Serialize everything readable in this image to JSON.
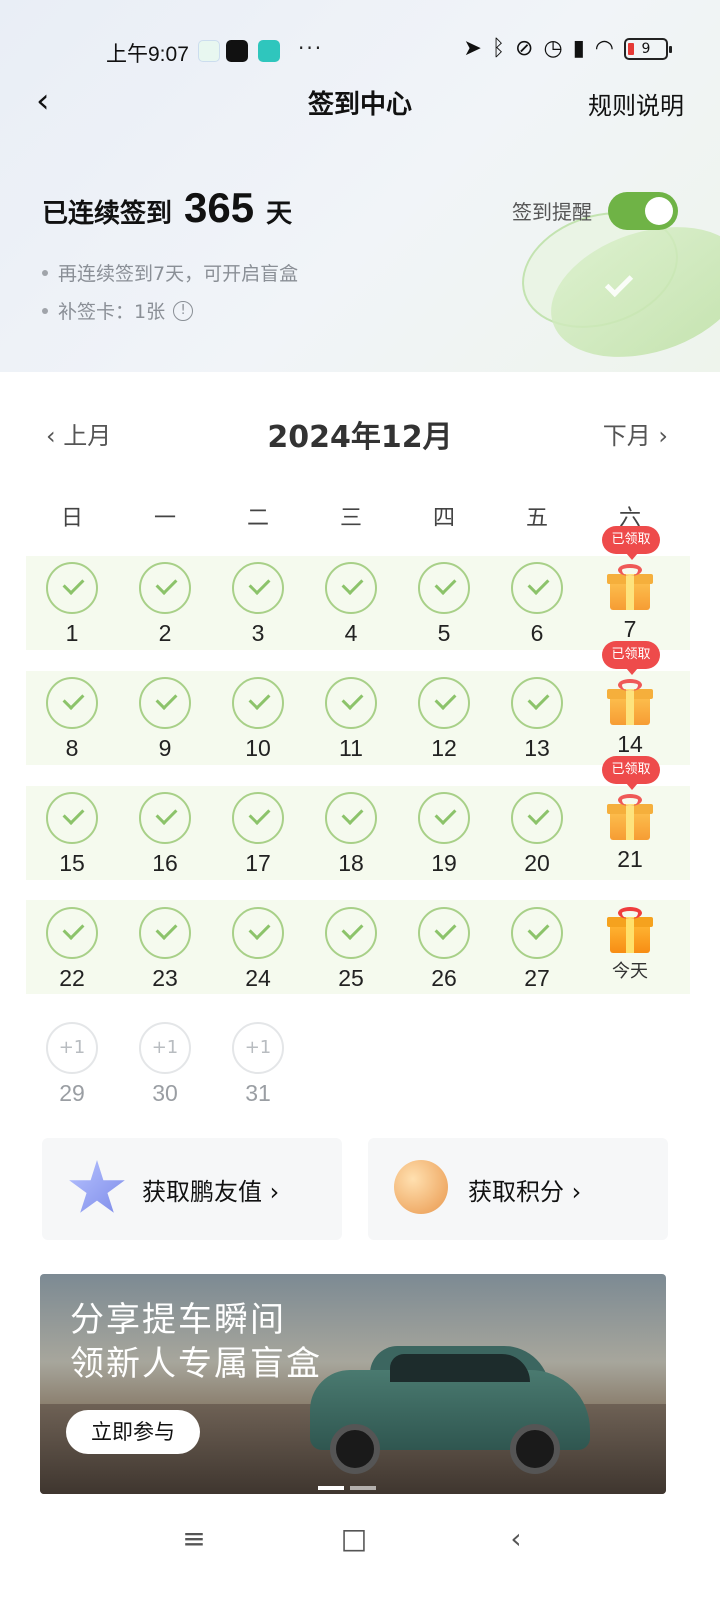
{
  "status_bar": {
    "time": "上午9:07",
    "dots": "···",
    "battery": "9"
  },
  "header": {
    "back": "‹",
    "title": "签到中心",
    "rules": "规则说明"
  },
  "streak": {
    "prefix": "已连续签到",
    "days": "365",
    "suffix": "天"
  },
  "reminder": {
    "label": "签到提醒",
    "enabled": true
  },
  "tips": {
    "blind_box": "再连续签到7天，可开启盲盒",
    "makeup_card": "补签卡：1张"
  },
  "calendar": {
    "prev": "‹ 上月",
    "title": "2024年12月",
    "next": "下月 ›",
    "weekdays": [
      "日",
      "一",
      "二",
      "三",
      "四",
      "五",
      "六"
    ],
    "claimed_badge": "已领取",
    "today_label": "今天",
    "future_bonus": "+1",
    "week1": [
      "1",
      "2",
      "3",
      "4",
      "5",
      "6",
      "7"
    ],
    "week2": [
      "8",
      "9",
      "10",
      "11",
      "12",
      "13",
      "14"
    ],
    "week3": [
      "15",
      "16",
      "17",
      "18",
      "19",
      "20",
      "21"
    ],
    "week4": [
      "22",
      "23",
      "24",
      "25",
      "26",
      "27"
    ],
    "week5": [
      "29",
      "30",
      "31"
    ]
  },
  "cards": {
    "friend_value": "获取鹏友值 ›",
    "points": "获取积分 ›"
  },
  "banner": {
    "line1": "分享提车瞬间",
    "line2": "领新人专属盲盒",
    "button": "立即参与"
  },
  "nav": {
    "menu": "≡",
    "home": "□",
    "back": "‹"
  },
  "colors": {
    "accent_green": "#6fb346",
    "badge_red": "#ee4b4b"
  }
}
